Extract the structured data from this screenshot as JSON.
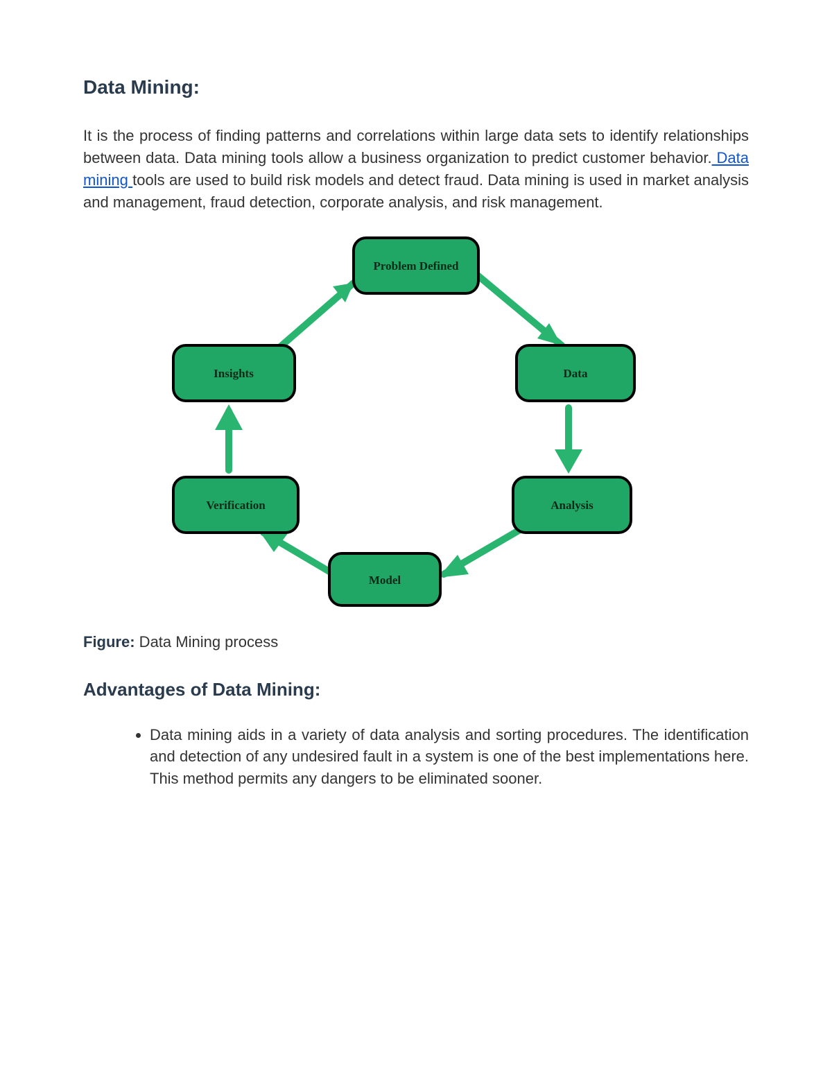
{
  "heading": "Data Mining:",
  "intro_part1": "It is the process of finding patterns and correlations within large data sets to identify relationships between data. Data mining tools allow a business organization to predict customer behavior.",
  "intro_link": " Data mining ",
  "intro_part2": "tools are used to build risk models and detect fraud. Data mining is used in market analysis and management, fraud detection, corporate analysis, and risk management.",
  "figure_label": "Figure:",
  "figure_text": " Data Mining process",
  "advantages_heading": "Advantages of Data Mining:",
  "bullet1": "Data mining aids in a variety of data analysis and sorting procedures. The identification and detection of any undesired fault in a system is one of the best implementations here. This method permits any dangers to be eliminated sooner.",
  "diagram": {
    "nodes": {
      "problem": "Problem Defined",
      "data": "Data",
      "analysis": "Analysis",
      "model": "Model",
      "verification": "Verification",
      "insights": "Insights"
    }
  }
}
